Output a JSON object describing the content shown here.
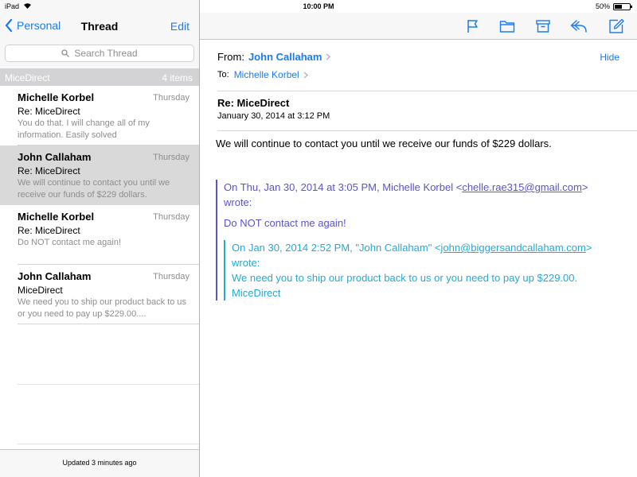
{
  "status_bar": {
    "device": "iPad",
    "time": "10:00 PM",
    "battery_percent": "50%",
    "battery_level": 0.5
  },
  "left_nav": {
    "back_label": "Personal",
    "title": "Thread",
    "edit_label": "Edit"
  },
  "search": {
    "placeholder": "Search Thread"
  },
  "group": {
    "name": "MiceDirect",
    "count": "4 items"
  },
  "messages": [
    {
      "sender": "Michelle Korbel",
      "date": "Thursday",
      "subject": "Re: MiceDirect",
      "preview": "You do that. I will change all of my information. Easily solved"
    },
    {
      "sender": "John Callaham",
      "date": "Thursday",
      "subject": "Re: MiceDirect",
      "preview": "We will continue to contact you until we receive our funds of $229 dollars."
    },
    {
      "sender": "Michelle Korbel",
      "date": "Thursday",
      "subject": "Re: MiceDirect",
      "preview": "Do NOT contact me again!"
    },
    {
      "sender": "John Callaham",
      "date": "Thursday",
      "subject": "MiceDirect",
      "preview": "We need you to ship our product back to us or you need to pay up $229.00...."
    }
  ],
  "left_footer": "Updated 3 minutes ago",
  "toolbar_icons": [
    "flag-icon",
    "folder-icon",
    "archive-icon",
    "reply-icon",
    "compose-icon"
  ],
  "detail": {
    "from_label": "From:",
    "from_name": "John Callaham",
    "to_label": "To:",
    "to_name": "Michelle Korbel",
    "hide_label": "Hide",
    "subject": "Re: MiceDirect",
    "date": "January 30, 2014 at 3:12 PM",
    "body": "We will continue to contact you until we receive our funds of $229 dollars.",
    "quote1": {
      "header_prefix": "On Thu, Jan 30, 2014 at 3:05 PM, Michelle Korbel <",
      "email": "chelle.rae315@gmail.com",
      "header_suffix": ">",
      "wrote": "wrote:",
      "text": "Do NOT contact me again!"
    },
    "quote2": {
      "header_prefix": "On Jan 30, 2014 2:52 PM, \"John Callaham\" <",
      "email": "john@biggersandcallaham.com",
      "header_suffix": ">",
      "wrote": "wrote:",
      "line1": "We need you to ship our product back to us or you need to pay up $229.00.",
      "line2": "MiceDirect"
    }
  },
  "colors": {
    "accent": "#1a7cf5",
    "quote_level1": "#5a54cf",
    "quote_level2": "#27a9d5",
    "selected_row": "#d9d9d9"
  }
}
